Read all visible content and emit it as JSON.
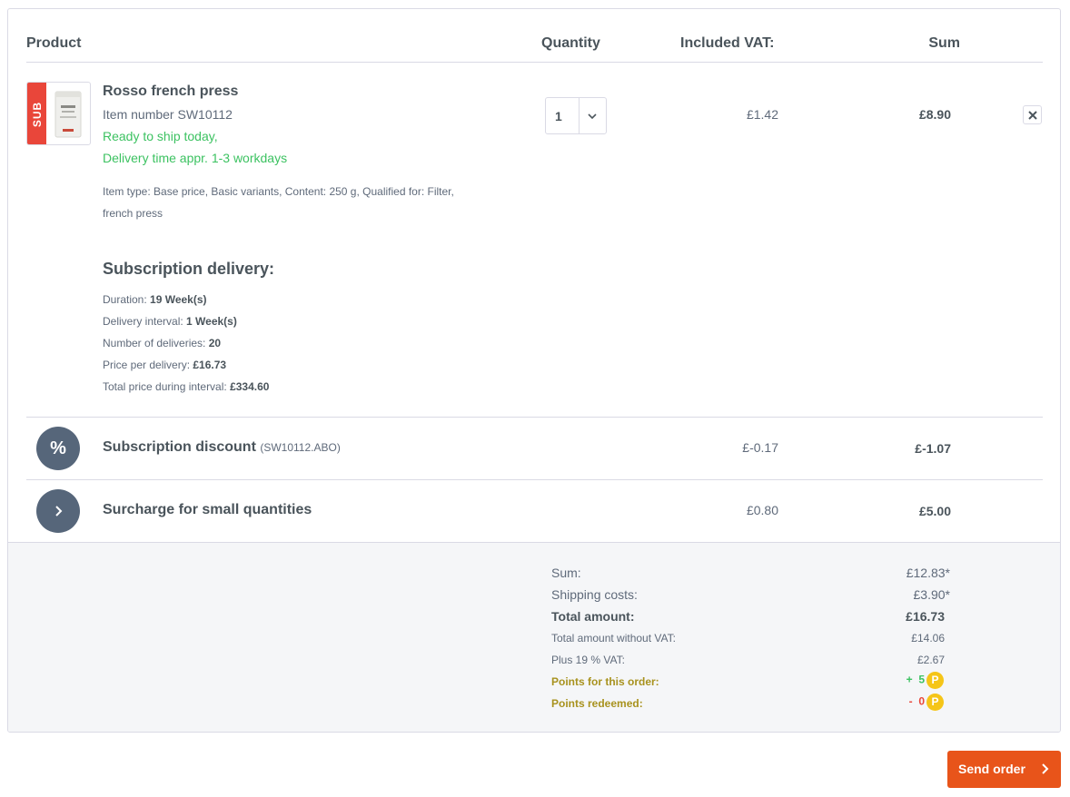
{
  "table": {
    "headers": {
      "product": "Product",
      "quantity": "Quantity",
      "vat": "Included VAT:",
      "sum": "Sum"
    }
  },
  "product": {
    "badge": "SUB",
    "name": "Rosso french press",
    "number": "Item number SW10112",
    "ship1": "Ready to ship today,",
    "ship2": "Delivery time appr. 1-3 workdays",
    "desc1": "Item type: Base price, Basic variants, Content: 250 g, Qualified for: Filter,",
    "desc2": "french press",
    "quantity": "1",
    "vat": "£1.42",
    "sum": "£8.90"
  },
  "subscription": {
    "heading": "Subscription delivery:",
    "duration_label": "Duration: ",
    "duration_value": "19 Week(s)",
    "interval_label": "Delivery interval: ",
    "interval_value": "1 Week(s)",
    "deliveries_label": "Number of deliveries: ",
    "deliveries_value": "20",
    "price_label": "Price per delivery: ",
    "price_value": "£16.73",
    "total_label": "Total price during interval: ",
    "total_value": "£334.60"
  },
  "discount": {
    "icon": "%",
    "label": "Subscription discount",
    "code": "(SW10112.ABO)",
    "vat": "£-0.17",
    "sum": "£-1.07"
  },
  "surcharge": {
    "label": "Surcharge for small quantities",
    "vat": "£0.80",
    "sum": "£5.00"
  },
  "totals": {
    "sum_label": "Sum:",
    "sum_value": "£12.83*",
    "shipping_label": "Shipping costs:",
    "shipping_value": "£3.90*",
    "total_label": "Total amount:",
    "total_value": "£16.73",
    "net_label": "Total amount without VAT:",
    "net_value": "£14.06",
    "vat_label": "Plus 19 % VAT:",
    "vat_value": "£2.67",
    "points_label": "Points for this order:",
    "points_sign": "+",
    "points_value": "5",
    "redeemed_label": "Points redeemed:",
    "redeemed_sign": "-",
    "redeemed_value": "0",
    "coin": "P"
  },
  "actions": {
    "send": "Send order"
  },
  "colors": {
    "accent": "#e8541a",
    "badge": "#e9463a",
    "green": "#3cc261",
    "points": "#a8921e",
    "coin": "#f5c518"
  }
}
